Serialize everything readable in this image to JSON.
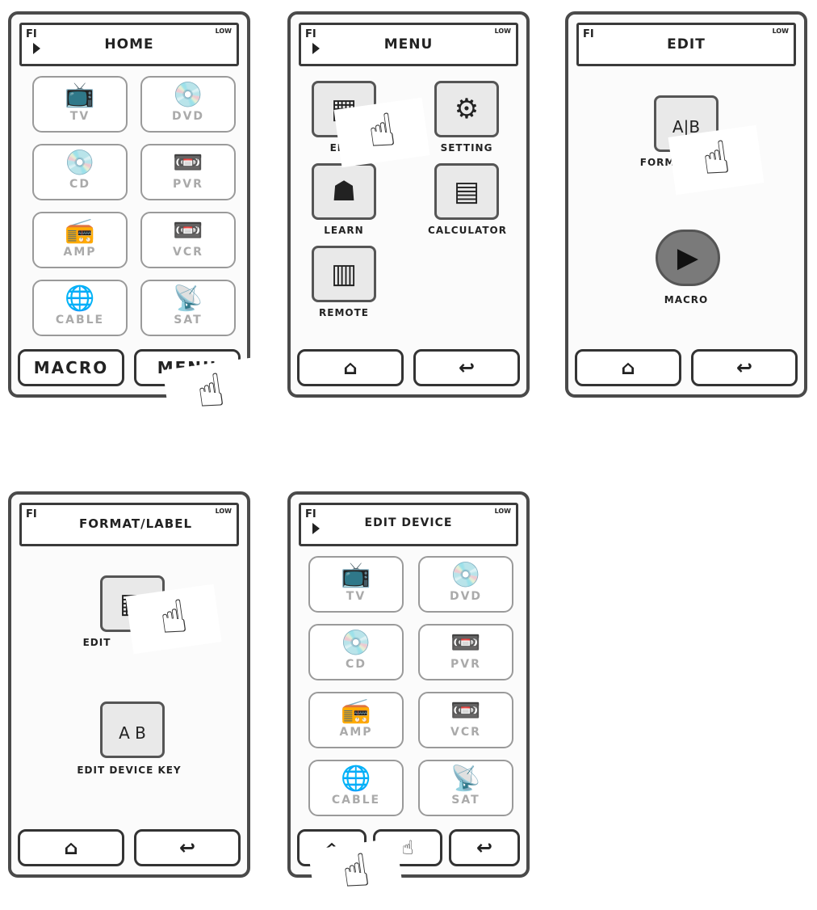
{
  "status": {
    "fi": "FI",
    "battery": "LOW"
  },
  "devices": [
    {
      "label": "TV",
      "icon": "tv-icon",
      "glyph": "📺"
    },
    {
      "label": "DVD",
      "icon": "dvd-icon",
      "glyph": "💿"
    },
    {
      "label": "CD",
      "icon": "cd-icon",
      "glyph": "💿"
    },
    {
      "label": "PVR",
      "icon": "pvr-icon",
      "glyph": "📼"
    },
    {
      "label": "AMP",
      "icon": "amp-icon",
      "glyph": "📻"
    },
    {
      "label": "VCR",
      "icon": "vcr-icon",
      "glyph": "📼"
    },
    {
      "label": "CABLE",
      "icon": "cable-icon",
      "glyph": "🌐"
    },
    {
      "label": "SAT",
      "icon": "satellite-icon",
      "glyph": "📡"
    }
  ],
  "screens": {
    "home": {
      "title": "HOME",
      "buttons": {
        "macro": "MACRO",
        "menu": "MENU"
      }
    },
    "menu": {
      "title": "MENU",
      "items": [
        {
          "label": "EDIT",
          "icon": "edit-icon",
          "glyph": "▦"
        },
        {
          "label": "SETTING",
          "icon": "setting-icon",
          "glyph": "⚙"
        },
        {
          "label": "LEARN",
          "icon": "learn-icon",
          "glyph": "☗"
        },
        {
          "label": "CALCULATOR",
          "icon": "calculator-icon",
          "glyph": "▤"
        },
        {
          "label": "REMOTE",
          "icon": "remote-icon",
          "glyph": "▥"
        }
      ]
    },
    "edit": {
      "title": "EDIT",
      "items": [
        {
          "label": "FORMAT/LABEL",
          "icon": "format-label-icon",
          "glyph": "A|B"
        },
        {
          "label": "MACRO",
          "icon": "macro-play-icon",
          "glyph": "▶"
        }
      ]
    },
    "format_label": {
      "title": "FORMAT/LABEL",
      "items": [
        {
          "label": "EDIT",
          "icon": "edit-icon",
          "glyph": "▦"
        },
        {
          "label": "EDIT DEVICE KEY",
          "icon": "edit-device-key-icon",
          "glyph": "A B"
        }
      ]
    },
    "edit_device": {
      "title": "EDIT DEVICE"
    }
  },
  "nav": {
    "home_glyph": "⌂",
    "back_glyph": "↩",
    "extra_glyph": "☝"
  },
  "pointer": {
    "glyph": "☝"
  }
}
